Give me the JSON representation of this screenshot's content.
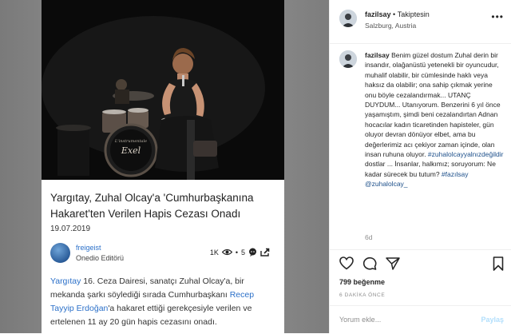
{
  "article": {
    "headline": "Yargıtay, Zuhal Olcay'a 'Cumhurbaşkanına Hakaret'ten Verilen Hapis Cezası Onadı",
    "date": "19.07.2019",
    "author_name": "freigeist",
    "author_role": "Onedio Editörü",
    "views": "1K",
    "comments_count": "5",
    "body_parts": [
      {
        "text": "Yargıtay",
        "link": true
      },
      {
        "text": " 16. Ceza Dairesi, sanatçı Zuhal Olcay'a, bir mekanda şarkı söylediği sırada Cumhurbaşkanı ",
        "link": false
      },
      {
        "text": "Recep Tayyip Erdoğan",
        "link": true
      },
      {
        "text": "'a hakaret ettiği gerekçesiyle verilen ve ertelenen 11 ay 20 gün hapis cezasını onadı.",
        "link": false
      }
    ],
    "photo_texts": {
      "drum_brand": "Exel",
      "drum_sub": "L'instrumentale"
    }
  },
  "post": {
    "username": "fazilsay",
    "separator": "•",
    "follow_state": "Takiptesin",
    "location": "Salzburg, Austria",
    "more_icon": "more-icon",
    "caption_user": "fazilsay",
    "caption_text": "Benim güzel dostum Zuhal derin bir insandır, olağanüstü yetenekli bir oyuncudur, muhalif olabilir, bir cümlesinde haklı veya haksız da olabilir; ona sahip çıkmak yerine onu böyle cezalandırmak... UTANÇ DUYDUM... Utanıyorum. Benzerini 6 yıl önce yaşamıştım, şimdi beni cezalandırtan Adnan hocacılar kadın ticaretinden hapisteler, gün oluyor devran dönüyor elbet, ama bu değerlerimiz acı çekiyor zaman içinde, olan insan ruhuna oluyor. ",
    "caption_tag1": "#zuhalolcayyalnızdeğildir",
    "caption_text2": " dostlar ... İnsanlar, halkımız; soruyorum: Ne kadar sürecek bu tutum? ",
    "caption_tag2": "#fazılsay",
    "caption_mention": "@zuhalolcay_",
    "time": "6d",
    "likes": "799 beğenme",
    "ago": "6 DAKİKA ÖNCE",
    "comment_placeholder": "Yorum ekle...",
    "post_label": "Paylaş"
  },
  "colors": {
    "link": "#2b70c9",
    "tag": "#1c4f8a",
    "muted": "#8e8e8e",
    "post_disabled": "#b2dffc"
  }
}
